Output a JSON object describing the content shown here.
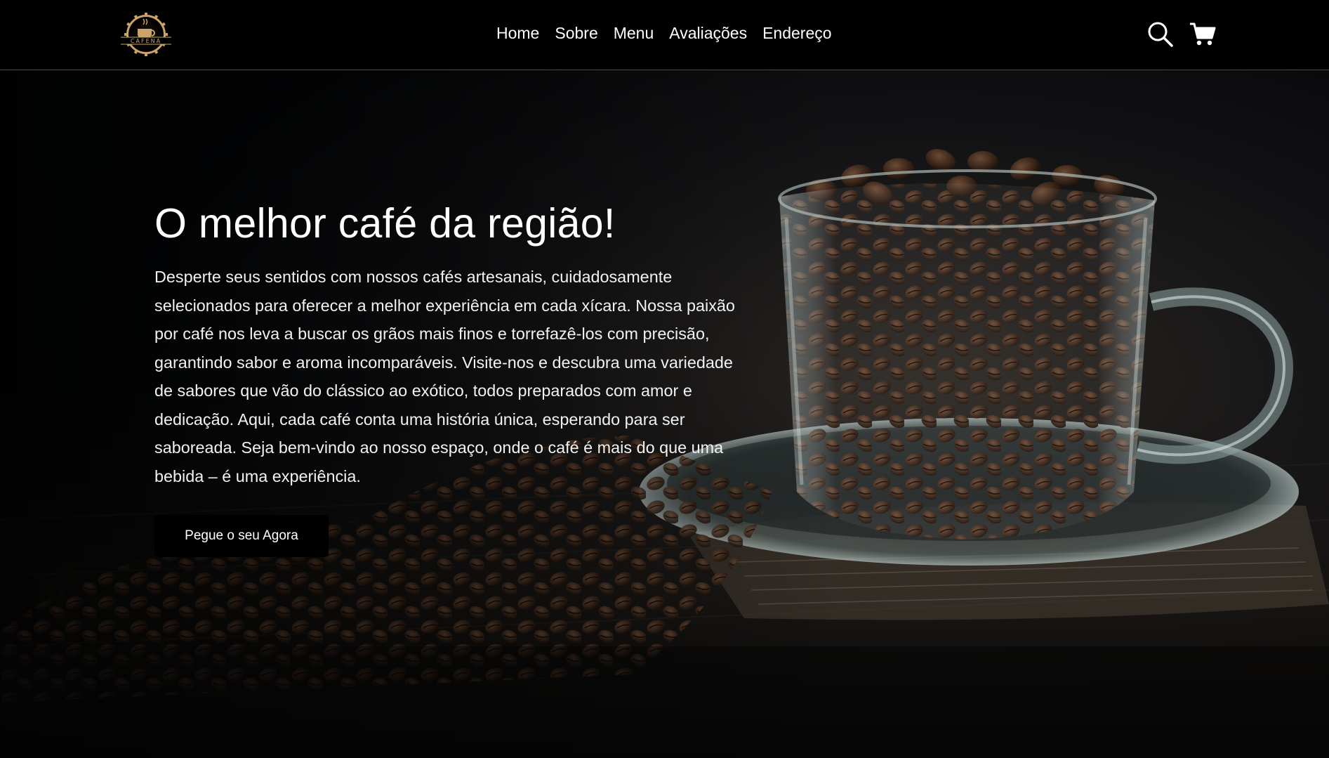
{
  "header": {
    "logo_text": "CAFENA",
    "nav": [
      {
        "label": "Home"
      },
      {
        "label": "Sobre"
      },
      {
        "label": "Menu"
      },
      {
        "label": "Avaliações"
      },
      {
        "label": "Endereço"
      }
    ],
    "icons": [
      "search-icon",
      "cart-icon"
    ]
  },
  "hero": {
    "title": "O melhor café da região!",
    "description": "Desperte seus sentidos com nossos cafés artesanais, cuidadosamente selecionados para oferecer a melhor experiência em cada xícara. Nossa paixão por café nos leva a buscar os grãos mais finos e torrefazê-los com precisão, garantindo sabor e aroma incomparáveis. Visite-nos e descubra uma variedade de sabores que vão do clássico ao exótico, todos preparados com amor e dedicação. Aqui, cada café conta uma história única, esperando para ser saboreada. Seja bem-vindo ao nosso espaço, onde o café é mais do que uma bebida – é uma experiência.",
    "cta_label": "Pegue o seu Agora"
  },
  "colors": {
    "background": "#000000",
    "text": "#ffffff",
    "logo_gold": "#c9a36a",
    "divider": "#4a4a4a"
  }
}
